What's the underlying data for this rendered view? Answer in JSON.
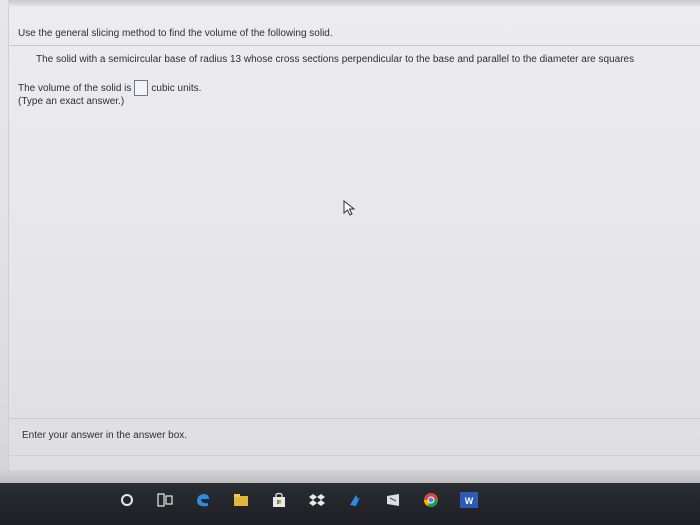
{
  "question": {
    "instruction": "Use the general slicing method to find the volume of the following solid.",
    "problem": "The solid with a semicircular base of radius 13 whose cross sections perpendicular to the base and parallel to the diameter are squares",
    "answer_prefix": "The volume of the solid is",
    "answer_value": "",
    "answer_suffix": "cubic units.",
    "hint": "(Type an exact answer.)"
  },
  "footer": {
    "prompt": "Enter your answer in the answer box."
  },
  "taskbar": {
    "icons": [
      "cortana-circle-icon",
      "task-view-icon",
      "edge-browser-icon",
      "file-explorer-icon",
      "store-bag-icon",
      "dropbox-icon",
      "app-icon",
      "app-icon-2",
      "chrome-icon",
      "word-icon"
    ]
  },
  "colors": {
    "text": "#2e2e34",
    "taskbar": "#1f2126",
    "edge_blue": "#2f8be0",
    "word_blue": "#2b5bb5"
  }
}
